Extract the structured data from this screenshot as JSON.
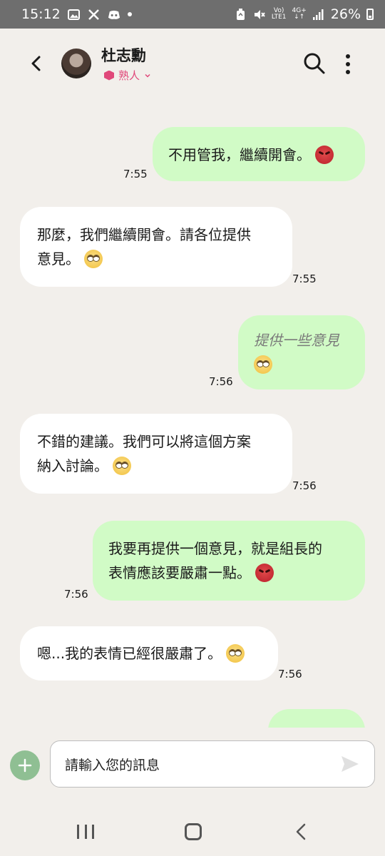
{
  "status_bar": {
    "time": "15:12",
    "left_icons": [
      "image-icon",
      "x-logo-icon",
      "discord-icon",
      "dot-icon"
    ],
    "network_label_top": "Vo)",
    "network_label_bottom": "LTE1",
    "network_type_top": "4G+",
    "network_type_bottom": "↓↑",
    "battery": "26%",
    "right_icons": [
      "recycle-icon",
      "mute-icon",
      "signal-icon",
      "battery-icon"
    ]
  },
  "header": {
    "contact_name": "杜志勳",
    "relationship": "熟人",
    "icons": [
      "back-arrow-icon",
      "avatar",
      "search-icon",
      "more-vertical-icon"
    ],
    "accent_color": "#e0487a"
  },
  "messages": [
    {
      "side": "sent",
      "text": "不用管我，繼續開會。",
      "emoji": "angry-face-icon",
      "time": "7:55"
    },
    {
      "side": "received",
      "line1": "那麼，我們繼續開會。請各位提供",
      "line2": "意見。",
      "emoji": "eye-roll-face-icon",
      "time": "7:55"
    },
    {
      "side": "sent",
      "text": "提供一些意見",
      "italic": true,
      "emoji": "eye-roll-face-icon",
      "time": "7:56"
    },
    {
      "side": "received",
      "line1": "不錯的建議。我們可以將這個方案",
      "line2": "納入討論。",
      "emoji": "eye-roll-face-icon",
      "time": "7:56"
    },
    {
      "side": "sent",
      "line1": "我要再提供一個意見，就是組長的",
      "line2": "表情應該要嚴肅一點。",
      "emoji": "angry-face-icon",
      "time": "7:56"
    },
    {
      "side": "received",
      "text": "嗯...我的表情已經很嚴肅了。",
      "emoji": "eye-roll-face-icon",
      "time": "7:56"
    }
  ],
  "input": {
    "placeholder": "請輸入您的訊息",
    "icons": [
      "add-icon",
      "send-icon"
    ]
  },
  "colors": {
    "sent_bubble": "#d1fbc6",
    "received_bubble": "#ffffff",
    "background": "#f2efeb",
    "add_button": "#8fbf93"
  },
  "nav_bar": {
    "icons": [
      "recents-icon",
      "home-icon",
      "back-icon"
    ]
  }
}
